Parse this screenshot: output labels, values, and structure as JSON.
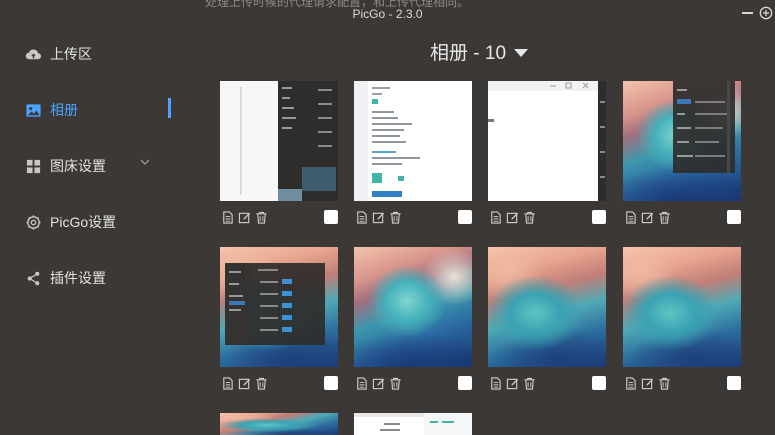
{
  "window": {
    "title": "PicGo - 2.3.0",
    "ghost_text": "处理上传时候的代理请求配置，和上传代理相同。"
  },
  "sidebar": {
    "items": [
      {
        "label": "上传区",
        "icon": "cloud-upload-icon"
      },
      {
        "label": "相册",
        "icon": "image-icon"
      },
      {
        "label": "图床设置",
        "icon": "grid-icon"
      },
      {
        "label": "PicGo设置",
        "icon": "gear-icon"
      },
      {
        "label": "插件设置",
        "icon": "share-icon"
      }
    ],
    "active": "相册"
  },
  "gallery": {
    "title": "相册 - 10",
    "items": [
      {
        "kind": "settings-screenshot-light"
      },
      {
        "kind": "upload-panel-screenshot"
      },
      {
        "kind": "blank-window-screenshot"
      },
      {
        "kind": "wave-with-menu-screenshot"
      },
      {
        "kind": "wave-with-settings-dialog"
      },
      {
        "kind": "wave-art"
      },
      {
        "kind": "wave-art"
      },
      {
        "kind": "wave-art"
      },
      {
        "kind": "wave-art-partial"
      },
      {
        "kind": "settings-screenshot-partial"
      }
    ]
  },
  "colors": {
    "background": "#3b3835",
    "accent": "#4aa3ff",
    "text": "#e6e6e6"
  }
}
